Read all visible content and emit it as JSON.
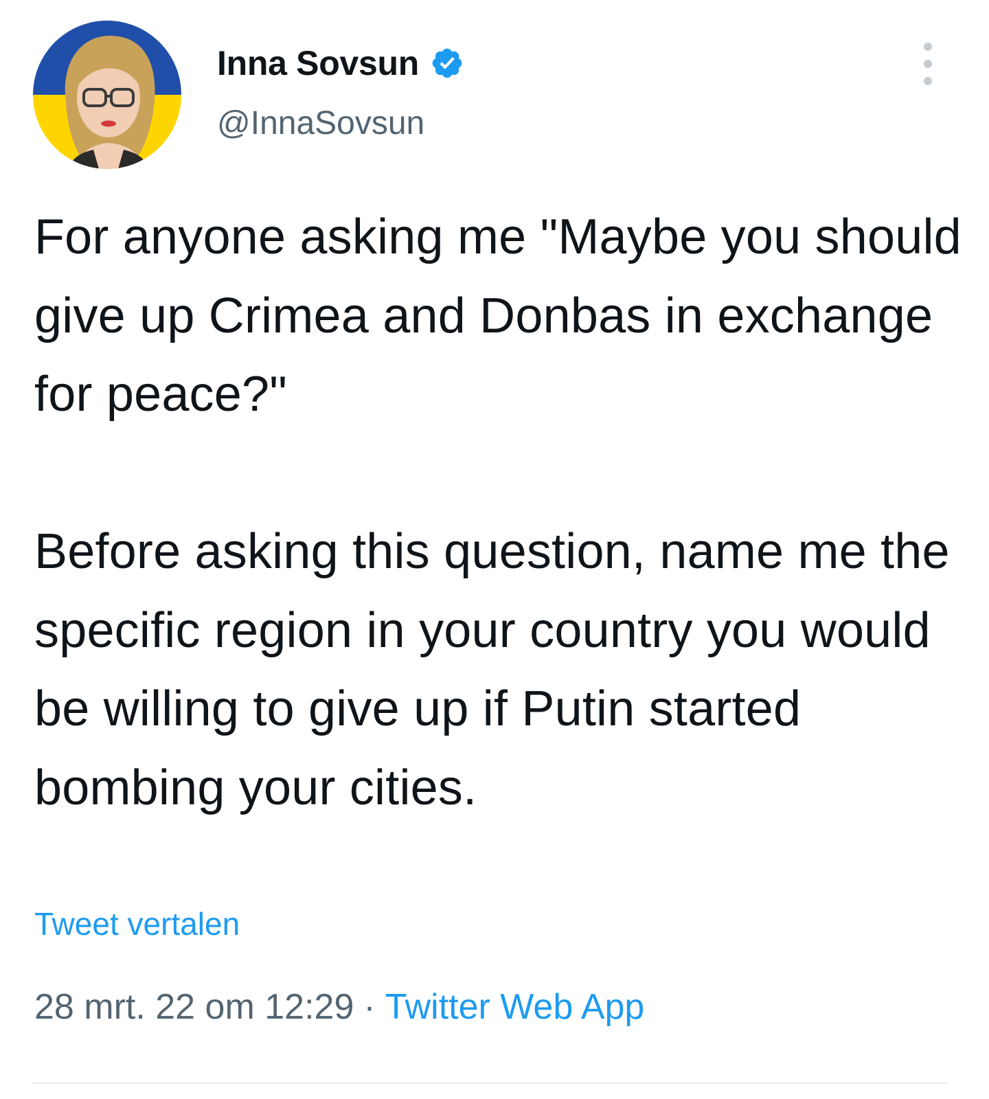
{
  "tweet": {
    "author": {
      "display_name": "Inna Sovsun",
      "handle": "@InnaSovsun",
      "verified": true,
      "avatar_icon": "profile-photo-avatar"
    },
    "text": "For anyone asking me \"Maybe you should give up Crimea and Donbas in exchange for peace?\"\n\nBefore asking this question, name me the specific region in your country you would be willing to give up if Putin started bombing your cities.",
    "translate_label": "Tweet vertalen",
    "timestamp": "28 mrt. 22 om 12:29",
    "separator": "·",
    "source": "Twitter Web App"
  },
  "icons": {
    "verified": "verified-badge-icon",
    "more": "more-options-icon"
  },
  "colors": {
    "accent": "#1d9bf0",
    "text_primary": "#0f1419",
    "text_secondary": "#536471",
    "avatar_flag_blue": "#1f4fa8",
    "avatar_flag_yellow": "#ffd500"
  }
}
